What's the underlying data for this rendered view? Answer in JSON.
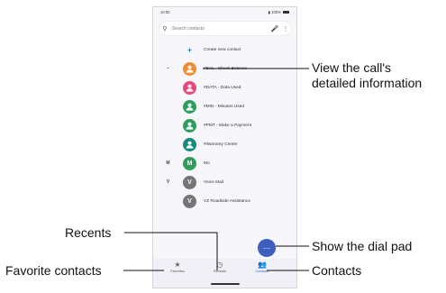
{
  "status_bar": {
    "time": "10:00",
    "battery": "100%"
  },
  "search": {
    "placeholder": "Search contacts"
  },
  "create_contact": {
    "label": "Create new contact"
  },
  "contacts": [
    {
      "section": "–",
      "initial": "",
      "name": "#BAL - Check Balance",
      "color": "#f28a30",
      "icon": "person-icon"
    },
    {
      "section": "",
      "initial": "",
      "name": "#DATA - Data Used",
      "color": "#e8477a",
      "icon": "person-icon"
    },
    {
      "section": "",
      "initial": "",
      "name": "#MIN - Minutes Used",
      "color": "#2e9e5a",
      "icon": "person-icon"
    },
    {
      "section": "",
      "initial": "",
      "name": "#PMT - Make a Payment",
      "color": "#2e9e5a",
      "icon": "person-icon"
    },
    {
      "section": "",
      "initial": "",
      "name": "#Warranty Center",
      "color": "#14897e",
      "icon": "person-icon"
    },
    {
      "section": "M",
      "initial": "M",
      "name": "Mo",
      "color": "#2e9e5a",
      "icon": "letter"
    },
    {
      "section": "V",
      "initial": "V",
      "name": "Voice Mail",
      "color": "#757575",
      "icon": "letter"
    },
    {
      "section": "",
      "initial": "V",
      "name": "VZ Roadside Assistance",
      "color": "#757575",
      "icon": "letter"
    }
  ],
  "nav": [
    {
      "label": "Favorites",
      "icon": "star-icon"
    },
    {
      "label": "Recents",
      "icon": "clock-icon"
    },
    {
      "label": "Contacts",
      "icon": "people-icon"
    }
  ],
  "callouts": {
    "detail": "View the call's\ndetailed information",
    "dialpad": "Show the dial pad",
    "recents": "Recents",
    "favorites": "Favorite contacts",
    "contacts": "Contacts"
  }
}
